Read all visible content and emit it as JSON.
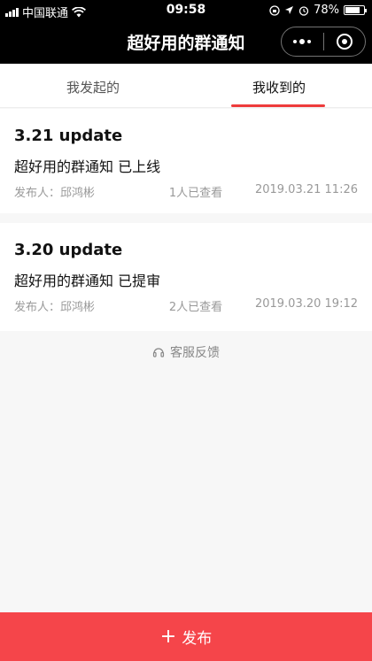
{
  "status_bar": {
    "carrier": "中国联通",
    "time": "09:58",
    "battery": "78%",
    "battery_level": 0.78
  },
  "nav": {
    "title": "超好用的群通知"
  },
  "tabs": [
    {
      "label": "我发起的"
    },
    {
      "label": "我收到的"
    }
  ],
  "notices": [
    {
      "title": "3.21 update",
      "content": "超好用的群通知 已上线",
      "publisher": "发布人：邱鸿彬",
      "views": "1人已查看",
      "time": "2019.03.21 11:26"
    },
    {
      "title": "3.20 update",
      "content": "超好用的群通知 已提审",
      "publisher": "发布人：邱鸿彬",
      "views": "2人已查看",
      "time": "2019.03.20 19:12"
    }
  ],
  "feedback": {
    "label": "客服反馈"
  },
  "publish": {
    "label": "发布"
  }
}
